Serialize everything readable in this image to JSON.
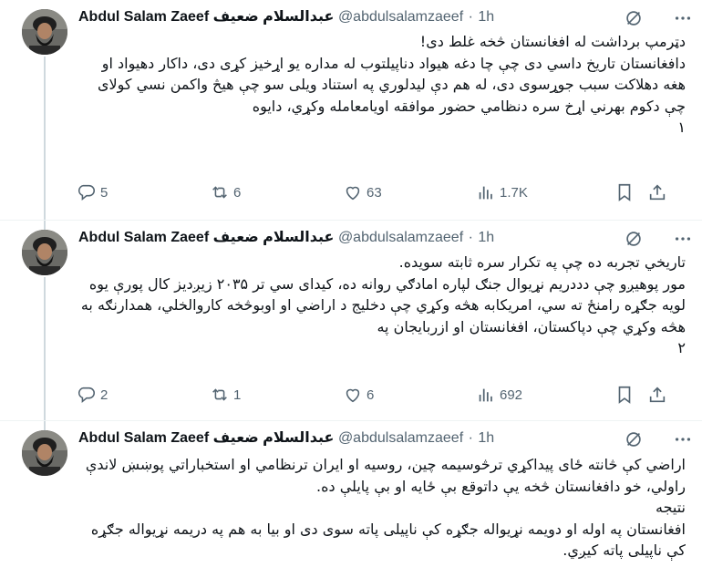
{
  "author": {
    "name": "Abdul Salam Zaeef",
    "name_native": "عبدالسلام ضعيف",
    "handle": "@abdulsalamzaeef",
    "separator": "·"
  },
  "colors": {
    "text": "#0f1419",
    "muted": "#536471",
    "divider": "#eff3f4",
    "thread_line": "#cfd9de"
  },
  "icons": {
    "grok": "grok-icon",
    "more": "more-icon",
    "reply": "reply-icon",
    "repost": "repost-icon",
    "like": "heart-icon",
    "views": "views-icon",
    "bookmark": "bookmark-icon",
    "share": "share-icon"
  },
  "tweets": [
    {
      "time": "1h",
      "lines": [
        "دټرمپ برداشت له افغانستان څخه غلط دی!",
        "دافغانستان تاریخ داسي دی چې چا دغه هیواد دناپیلتوب له مداره یو اړخیز کړی دی، داکار دهیواد او هغه دهلاکت سبب جوړسوی دی، له هم دې لیدلوري په استناد ویلی سو چې هیڅ واکمن نسي کولای چې دکوم بهرني اړخ سره دنظامي حضور موافقه اویامعامله وکړي، دایوه",
        "١"
      ],
      "replies": "5",
      "reposts": "6",
      "likes": "63",
      "views": "1.7K"
    },
    {
      "time": "1h",
      "lines": [
        "تاریخي تجربه ده چې په تکرار سره ثابته سویده.",
        "مور پوهیږو چې دددریم نړیوال جنګ لپاره امادګي روانه ده، کیدای سي تر ۲۰۳۵ زیږدیز کال پورې یوه لویه جګړه رامنځ ته سي، امریکابه هڅه وکړي چې دخلیج د اراضي او اوبوڅخه کاروالخلي، همدارنګه به هڅه وکړي چې دپاکستان، افغانستان او ازربایجان په",
        "۲"
      ],
      "replies": "2",
      "reposts": "1",
      "likes": "6",
      "views": "692"
    },
    {
      "time": "1h",
      "lines": [
        "اراضي کې څانته ځای پیداکړي ترڅوسیمه چین، روسیه او ایران ترنظامي او استخباراتي پوښښ لاندې راولي، خو دافغانستان څخه یې داتوقع بې ځایه او بې پایلې ده.",
        "نتیجه",
        "افغانستان په اوله او دویمه نړیواله جګړه کې ناپیلی پاته سوی دی او بیا به هم په دریمه نړیواله جګړه کې ناپیلی پاته کیږي."
      ]
    }
  ]
}
